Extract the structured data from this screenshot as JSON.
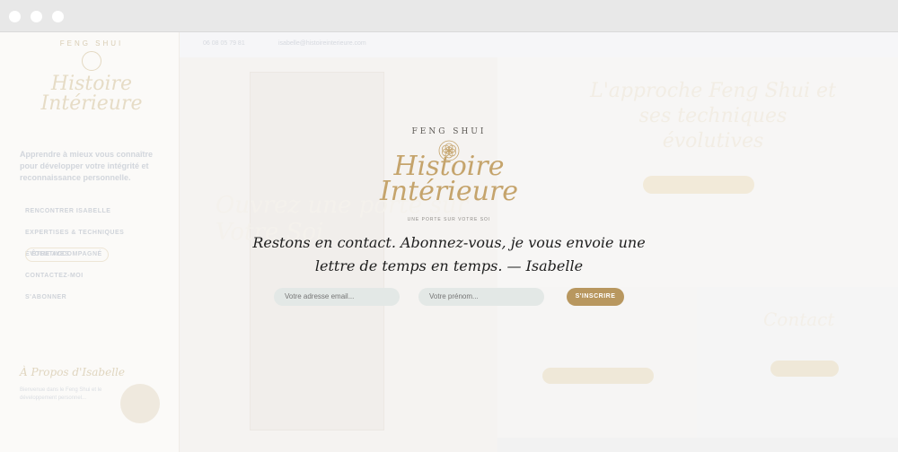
{
  "browser": {
    "controls": [
      "close",
      "minimize",
      "maximize"
    ]
  },
  "sidebar": {
    "logo_top": "FENG SHUI",
    "logo_script": "Histoire Intérieure",
    "intro": "Apprendre à mieux vous connaître pour développer votre intégrité et reconnaissance personnelle.",
    "menu": [
      "RENCONTRER ISABELLE",
      "EXPERTISES & TECHNIQUES ÉVOLUTIVES",
      "ÊTRE ACCOMPAGNÉ",
      "CONTACTEZ-MOI",
      "S'ABONNER"
    ],
    "about_title": "À Propos d'Isabelle",
    "about_text": "Bienvenue dans le Feng Shui et le développement personnel..."
  },
  "topbar": {
    "phone": "06 08 05 79 81",
    "email": "isabelle@histoireinterieure.com"
  },
  "background": {
    "hero_title": "Ouvrez une porte sur Votre Soi",
    "right_title": "L'approche Feng Shui et ses techniques évolutives",
    "contact_title": "Contact"
  },
  "popup": {
    "logo_top": "FENG SHUI",
    "logo_line1": "Histoire",
    "logo_line2": "Intérieure",
    "logo_tagline": "UNE PORTE SUR VOTRE SOI",
    "message_line1": "Restons en contact. Abonnez-vous, je vous envoie une",
    "message_line2": "lettre de temps en temps. — Isabelle",
    "email_placeholder": "Votre adresse email...",
    "name_placeholder": "Votre prénom...",
    "subscribe_label": "S'INSCRIRE",
    "accent_color": "#b8975f"
  }
}
